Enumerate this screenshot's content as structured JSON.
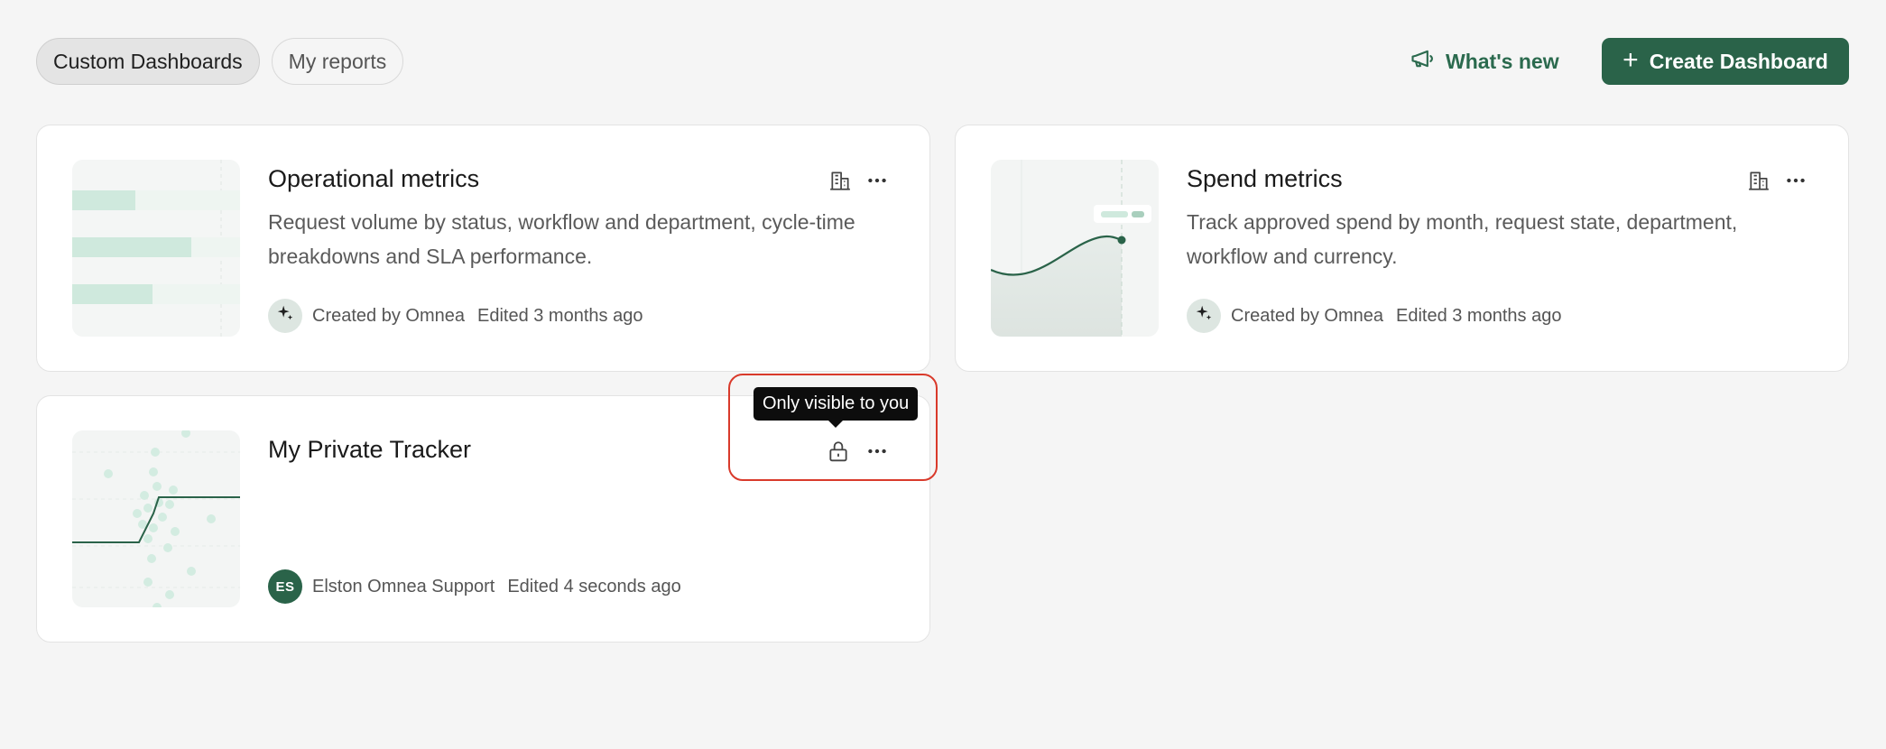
{
  "tabs": [
    {
      "label": "Custom Dashboards",
      "active": true
    },
    {
      "label": "My reports",
      "active": false
    }
  ],
  "header": {
    "whats_new_label": "What's new",
    "create_label": "Create Dashboard"
  },
  "colors": {
    "brand": "#2a6349",
    "highlight": "#d93a2b",
    "tooltip_bg": "#0d0d0d"
  },
  "cards": [
    {
      "title": "Operational metrics",
      "description": "Request volume by status, workflow and department, cycle-time breakdowns and SLA performance.",
      "creator": "Created by Omnea",
      "edited": "Edited 3 months ago",
      "visibility_icon": "building-icon",
      "avatar_type": "sparkle-icon"
    },
    {
      "title": "Spend metrics",
      "description": "Track approved spend by month, request state, department, workflow and currency.",
      "creator": "Created by Omnea",
      "edited": "Edited 3 months ago",
      "visibility_icon": "building-icon",
      "avatar_type": "sparkle-icon"
    },
    {
      "title": "My Private Tracker",
      "description": "",
      "creator": "Elston Omnea Support",
      "edited": "Edited 4 seconds ago",
      "visibility_icon": "lock-icon",
      "avatar_initials": "ES"
    }
  ],
  "tooltip": {
    "text": "Only visible to you"
  }
}
